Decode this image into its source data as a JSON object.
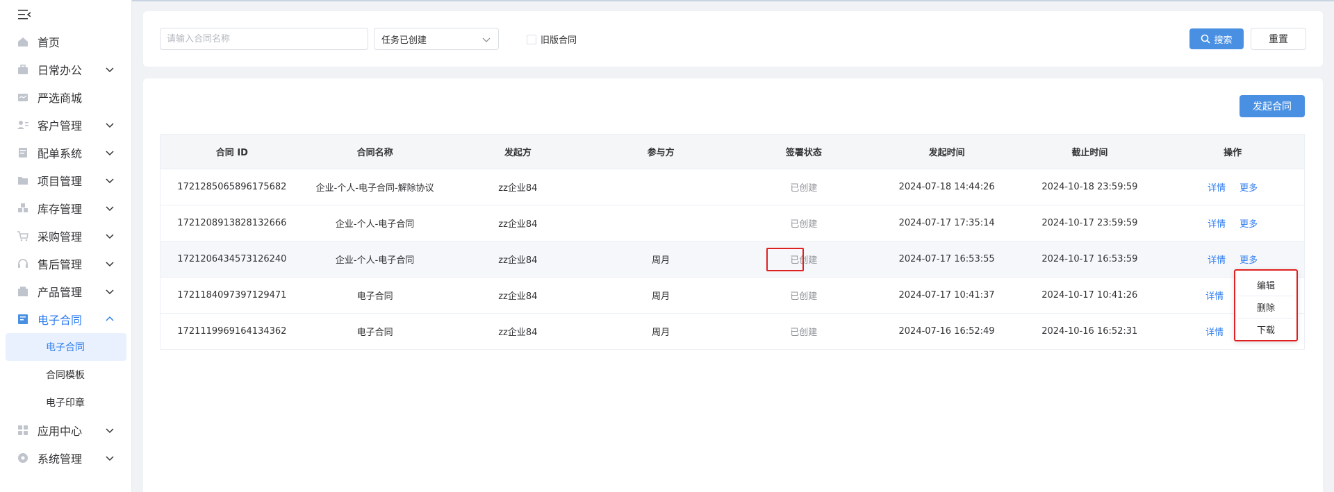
{
  "sidebar": {
    "items": [
      {
        "label": "首页",
        "icon": "home-icon"
      },
      {
        "label": "日常办公",
        "icon": "briefcase-icon"
      },
      {
        "label": "严选商城",
        "icon": "shop-icon"
      },
      {
        "label": "客户管理",
        "icon": "customer-icon"
      },
      {
        "label": "配单系统",
        "icon": "order-icon"
      },
      {
        "label": "项目管理",
        "icon": "folder-icon"
      },
      {
        "label": "库存管理",
        "icon": "inventory-icon"
      },
      {
        "label": "采购管理",
        "icon": "cart-icon"
      },
      {
        "label": "售后管理",
        "icon": "headset-icon"
      },
      {
        "label": "产品管理",
        "icon": "product-icon"
      },
      {
        "label": "电子合同",
        "icon": "contract-icon"
      },
      {
        "label": "应用中心",
        "icon": "apps-icon"
      },
      {
        "label": "系统管理",
        "icon": "settings-icon"
      }
    ],
    "sub_items": [
      {
        "label": "电子合同"
      },
      {
        "label": "合同模板"
      },
      {
        "label": "电子印章"
      }
    ]
  },
  "search": {
    "name_placeholder": "请输入合同名称",
    "status_value": "任务已创建",
    "old_version_label": "旧版合同",
    "search_label": "搜索",
    "reset_label": "重置"
  },
  "actions": {
    "create_label": "发起合同"
  },
  "table": {
    "headers": [
      "合同 ID",
      "合同名称",
      "发起方",
      "参与方",
      "签署状态",
      "发起时间",
      "截止时间",
      "操作"
    ],
    "rows": [
      {
        "id": "1721285065896175682",
        "name": "企业-个人-电子合同-解除协议",
        "initiator": "zz企业84",
        "participant": "",
        "status": "已创建",
        "start": "2024-07-18 14:44:26",
        "end": "2024-10-18 23:59:59",
        "detail": "详情",
        "more": "更多"
      },
      {
        "id": "1721208913828132666",
        "name": "企业-个人-电子合同",
        "initiator": "zz企业84",
        "participant": "",
        "status": "已创建",
        "start": "2024-07-17 17:35:14",
        "end": "2024-10-17 23:59:59",
        "detail": "详情",
        "more": "更多"
      },
      {
        "id": "1721206434573126240",
        "name": "企业-个人-电子合同",
        "initiator": "zz企业84",
        "participant": "周月",
        "status": "已创建",
        "start": "2024-07-17 16:53:55",
        "end": "2024-10-17 16:53:59",
        "detail": "详情",
        "more": "更多"
      },
      {
        "id": "1721184097397129471",
        "name": "电子合同",
        "initiator": "zz企业84",
        "participant": "周月",
        "status": "已创建",
        "start": "2024-07-17 10:41:37",
        "end": "2024-10-17 10:41:26",
        "detail": "详情",
        "more": ""
      },
      {
        "id": "1721119969164134362",
        "name": "电子合同",
        "initiator": "zz企业84",
        "participant": "周月",
        "status": "已创建",
        "start": "2024-07-16 16:52:49",
        "end": "2024-10-16 16:52:31",
        "detail": "详情",
        "more": ""
      }
    ]
  },
  "dropdown": {
    "items": [
      "编辑",
      "删除",
      "下载"
    ]
  },
  "colors": {
    "accent": "#4a90e2",
    "link": "#2f7df0",
    "highlight": "#e02020"
  }
}
